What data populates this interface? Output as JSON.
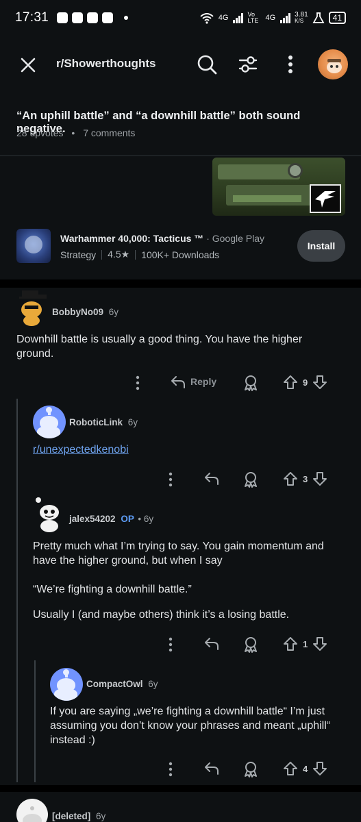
{
  "status_bar": {
    "time": "17:31",
    "network": "4G",
    "network2": "Vo LTE",
    "speed": "3.81",
    "speed_unit": "K/S",
    "battery": "41"
  },
  "header": {
    "subreddit": "r/Showerthoughts"
  },
  "post": {
    "title": "“An uphill battle” and “a downhill battle” both sound negative.",
    "upvotes": "28 upvotes",
    "comments": "7 comments"
  },
  "ad": {
    "name": "Warhammer 40,000: Tacticus ™",
    "source": "· Google Play",
    "category": "Strategy",
    "rating": "4.5★",
    "downloads": "100K+ Downloads",
    "install_label": "Install"
  },
  "comments": [
    {
      "author": "BobbyNo09",
      "age": "6y",
      "body": "Downhill battle is usually a good thing. You have the higher ground.",
      "votes": "9",
      "reply_label": "Reply"
    },
    {
      "author": "RoboticLink",
      "age": "6y",
      "body": "r/unexpectedkenobi",
      "votes": "3"
    },
    {
      "author": "jalex54202",
      "op": "OP",
      "age": "• 6y",
      "body1": "Pretty much what I’m trying to say. You gain momentum and have the higher ground, but when I say",
      "body2": "“We’re fighting a downhill battle.”",
      "body3": "Usually I (and maybe others) think it’s a losing battle.",
      "votes": "1"
    },
    {
      "author": "CompactOwl",
      "age": "6y",
      "body": "If you are saying „we’re fighting a downhill battle“ I’m just assuming you don’t know your phrases and meant „uphill“ instead :)",
      "votes": "4"
    },
    {
      "author": "[deleted]",
      "age": "6y"
    }
  ]
}
